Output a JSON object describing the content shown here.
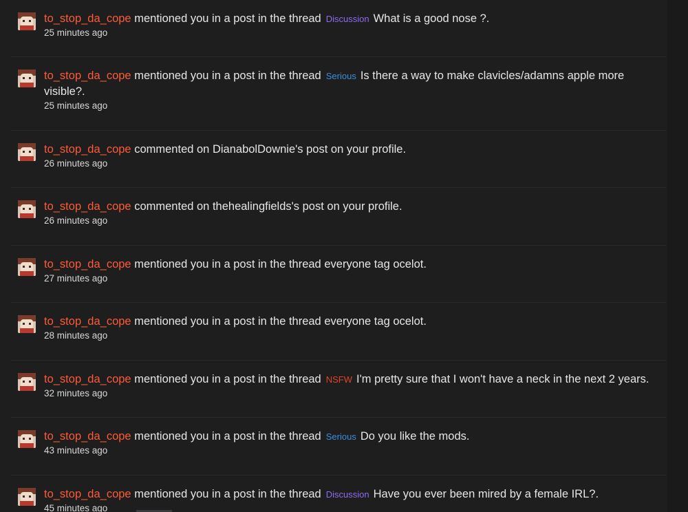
{
  "notifications": [
    {
      "user": "to_stop_da_cope",
      "action": "mentioned you in a post in the thread",
      "tag": "Discussion",
      "tag_color": "#8f6bf0",
      "title": "What is a good nose ?.",
      "time": "25 minutes ago"
    },
    {
      "user": "to_stop_da_cope",
      "action": "mentioned you in a post in the thread",
      "tag": "Serious",
      "tag_color": "#3b8ee0",
      "title": "Is there a way to make clavicles/adamns apple more visible?.",
      "time": "25 minutes ago"
    },
    {
      "user": "to_stop_da_cope",
      "action": "commented on",
      "link": "DianabolDownie's post",
      "suffix": "on your profile.",
      "time": "26 minutes ago"
    },
    {
      "user": "to_stop_da_cope",
      "action": "commented on",
      "link": "thehealingfields's post",
      "suffix": "on your profile.",
      "time": "26 minutes ago"
    },
    {
      "user": "to_stop_da_cope",
      "action": "mentioned you in a post in the thread",
      "title": "everyone tag ocelot.",
      "time": "27 minutes ago"
    },
    {
      "user": "to_stop_da_cope",
      "action": "mentioned you in a post in the thread",
      "title": "everyone tag ocelot.",
      "time": "28 minutes ago"
    },
    {
      "user": "to_stop_da_cope",
      "action": "mentioned you in a post in the thread",
      "tag": "NSFW",
      "tag_color": "#e0442a",
      "title": "I'm pretty sure that I won't have a neck in the next 2 years.",
      "time": "32 minutes ago"
    },
    {
      "user": "to_stop_da_cope",
      "action": "mentioned you in a post in the thread",
      "tag": "Serious",
      "tag_color": "#3b8ee0",
      "title": "Do you like the mods.",
      "time": "43 minutes ago"
    },
    {
      "user": "to_stop_da_cope",
      "action": "mentioned you in a post in the thread",
      "tag": "Discussion",
      "tag_color": "#8f6bf0",
      "title": "Have you ever been mired by a female IRL?.",
      "time": "45 minutes ago"
    }
  ],
  "avatar_icon": "anime-character-avatar"
}
